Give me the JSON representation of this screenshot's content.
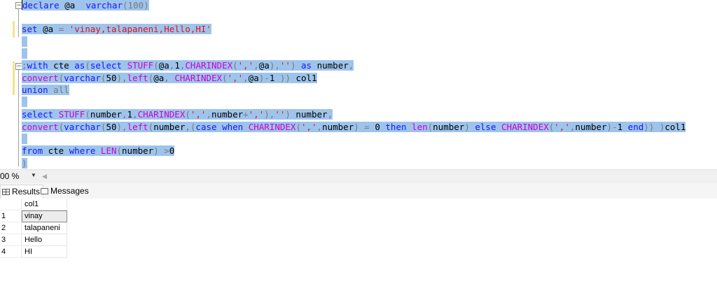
{
  "editor": {
    "lines": {
      "l1": [
        {
          "t": "declare",
          "c": "kw"
        },
        {
          "t": " @a  ",
          "c": "tx"
        },
        {
          "t": "varchar",
          "c": "kw"
        },
        {
          "t": "(100)",
          "c": "gr"
        }
      ],
      "l2": [
        {
          "t": "set",
          "c": "kw"
        },
        {
          "t": " @a ",
          "c": "tx"
        },
        {
          "t": "=",
          "c": "gr"
        },
        {
          "t": " ",
          "c": "tx"
        },
        {
          "t": "'vinay,talapaneni,Hello,HI'",
          "c": "st"
        }
      ],
      "l3": [
        {
          "t": ";",
          "c": "gr"
        },
        {
          "t": "with",
          "c": "kw"
        },
        {
          "t": " cte ",
          "c": "tx"
        },
        {
          "t": "as",
          "c": "kw"
        },
        {
          "t": "(",
          "c": "gr"
        },
        {
          "t": "select",
          "c": "kw"
        },
        {
          "t": " ",
          "c": "tx"
        },
        {
          "t": "STUFF",
          "c": "fn"
        },
        {
          "t": "(",
          "c": "gr"
        },
        {
          "t": "@a",
          "c": "tx"
        },
        {
          "t": ",",
          "c": "gr"
        },
        {
          "t": "1",
          "c": "tx"
        },
        {
          "t": ",",
          "c": "gr"
        },
        {
          "t": "CHARINDEX",
          "c": "fn"
        },
        {
          "t": "(",
          "c": "gr"
        },
        {
          "t": "','",
          "c": "st"
        },
        {
          "t": ",",
          "c": "gr"
        },
        {
          "t": "@a",
          "c": "tx"
        },
        {
          "t": "),",
          "c": "gr"
        },
        {
          "t": "''",
          "c": "st"
        },
        {
          "t": ")",
          "c": "gr"
        },
        {
          "t": " ",
          "c": "tx"
        },
        {
          "t": "as",
          "c": "kw"
        },
        {
          "t": " number",
          "c": "tx"
        },
        {
          "t": ",",
          "c": "gr"
        }
      ],
      "l4": [
        {
          "t": "convert",
          "c": "fn"
        },
        {
          "t": "(",
          "c": "gr"
        },
        {
          "t": "varchar",
          "c": "kw"
        },
        {
          "t": "(",
          "c": "gr"
        },
        {
          "t": "50",
          "c": "tx"
        },
        {
          "t": "),",
          "c": "gr"
        },
        {
          "t": "left",
          "c": "fn"
        },
        {
          "t": "(",
          "c": "gr"
        },
        {
          "t": "@a",
          "c": "tx"
        },
        {
          "t": ",",
          "c": "gr"
        },
        {
          "t": " ",
          "c": "tx"
        },
        {
          "t": "CHARINDEX",
          "c": "fn"
        },
        {
          "t": "(",
          "c": "gr"
        },
        {
          "t": "','",
          "c": "st"
        },
        {
          "t": ",",
          "c": "gr"
        },
        {
          "t": "@a",
          "c": "tx"
        },
        {
          "t": ")-",
          "c": "gr"
        },
        {
          "t": "1",
          "c": "tx"
        },
        {
          "t": " ))",
          "c": "gr"
        },
        {
          "t": " col1",
          "c": "tx"
        }
      ],
      "l5": [
        {
          "t": "union",
          "c": "kw"
        },
        {
          "t": " ",
          "c": "tx"
        },
        {
          "t": "all",
          "c": "gr"
        }
      ],
      "l6": [
        {
          "t": "select",
          "c": "kw"
        },
        {
          "t": " ",
          "c": "tx"
        },
        {
          "t": "STUFF",
          "c": "fn"
        },
        {
          "t": "(",
          "c": "gr"
        },
        {
          "t": "number",
          "c": "tx"
        },
        {
          "t": ",",
          "c": "gr"
        },
        {
          "t": "1",
          "c": "tx"
        },
        {
          "t": ",",
          "c": "gr"
        },
        {
          "t": "CHARINDEX",
          "c": "fn"
        },
        {
          "t": "(",
          "c": "gr"
        },
        {
          "t": "','",
          "c": "st"
        },
        {
          "t": ",",
          "c": "gr"
        },
        {
          "t": "number",
          "c": "tx"
        },
        {
          "t": "+",
          "c": "gr"
        },
        {
          "t": "','",
          "c": "st"
        },
        {
          "t": "),",
          "c": "gr"
        },
        {
          "t": "''",
          "c": "st"
        },
        {
          "t": ")",
          "c": "gr"
        },
        {
          "t": " number",
          "c": "tx"
        },
        {
          "t": ",",
          "c": "gr"
        }
      ],
      "l7": [
        {
          "t": "convert",
          "c": "fn"
        },
        {
          "t": "(",
          "c": "gr"
        },
        {
          "t": "varchar",
          "c": "kw"
        },
        {
          "t": "(",
          "c": "gr"
        },
        {
          "t": "50",
          "c": "tx"
        },
        {
          "t": "),",
          "c": "gr"
        },
        {
          "t": "left",
          "c": "fn"
        },
        {
          "t": "(",
          "c": "gr"
        },
        {
          "t": "number",
          "c": "tx"
        },
        {
          "t": ",(",
          "c": "gr"
        },
        {
          "t": "case",
          "c": "kw"
        },
        {
          "t": " ",
          "c": "tx"
        },
        {
          "t": "when",
          "c": "kw"
        },
        {
          "t": " ",
          "c": "tx"
        },
        {
          "t": "CHARINDEX",
          "c": "fn"
        },
        {
          "t": "(",
          "c": "gr"
        },
        {
          "t": "','",
          "c": "st"
        },
        {
          "t": ",",
          "c": "gr"
        },
        {
          "t": "number",
          "c": "tx"
        },
        {
          "t": ")",
          "c": "gr"
        },
        {
          "t": " ",
          "c": "tx"
        },
        {
          "t": "=",
          "c": "gr"
        },
        {
          "t": " 0 ",
          "c": "tx"
        },
        {
          "t": "then",
          "c": "kw"
        },
        {
          "t": " ",
          "c": "tx"
        },
        {
          "t": "len",
          "c": "fn"
        },
        {
          "t": "(",
          "c": "gr"
        },
        {
          "t": "number",
          "c": "tx"
        },
        {
          "t": ")",
          "c": "gr"
        },
        {
          "t": " ",
          "c": "tx"
        },
        {
          "t": "else",
          "c": "kw"
        },
        {
          "t": " ",
          "c": "tx"
        },
        {
          "t": "CHARINDEX",
          "c": "fn"
        },
        {
          "t": "(",
          "c": "gr"
        },
        {
          "t": "','",
          "c": "st"
        },
        {
          "t": ",",
          "c": "gr"
        },
        {
          "t": "number",
          "c": "tx"
        },
        {
          "t": ")-",
          "c": "gr"
        },
        {
          "t": "1",
          "c": "tx"
        },
        {
          "t": " ",
          "c": "tx"
        },
        {
          "t": "end",
          "c": "kw"
        },
        {
          "t": "))",
          "c": "gr"
        },
        {
          "t": " )",
          "c": "gr"
        },
        {
          "t": "col1",
          "c": "tx"
        }
      ],
      "l8": [
        {
          "t": "from",
          "c": "kw"
        },
        {
          "t": " cte ",
          "c": "tx"
        },
        {
          "t": "where",
          "c": "kw"
        },
        {
          "t": " ",
          "c": "tx"
        },
        {
          "t": "LEN",
          "c": "fn"
        },
        {
          "t": "(",
          "c": "gr"
        },
        {
          "t": "number",
          "c": "tx"
        },
        {
          "t": ")",
          "c": "gr"
        },
        {
          "t": " ",
          "c": "tx"
        },
        {
          "t": ">",
          "c": "gr"
        },
        {
          "t": "0",
          "c": "tx"
        }
      ],
      "l9": [
        {
          "t": ")",
          "c": "gr"
        }
      ]
    }
  },
  "zoom": {
    "value": "00 %"
  },
  "tabs": {
    "results": "Results",
    "messages": "Messages"
  },
  "grid": {
    "header": "col1",
    "rows": [
      {
        "n": "1",
        "v": "vinay"
      },
      {
        "n": "2",
        "v": "talapaneni"
      },
      {
        "n": "3",
        "v": "Hello"
      },
      {
        "n": "4",
        "v": "HI"
      }
    ]
  },
  "colors": {
    "selection": "#9ec4ec",
    "keyword": "#1515ff",
    "function": "#d000d0",
    "string": "#e0141e",
    "operator": "#7a7a7a"
  }
}
